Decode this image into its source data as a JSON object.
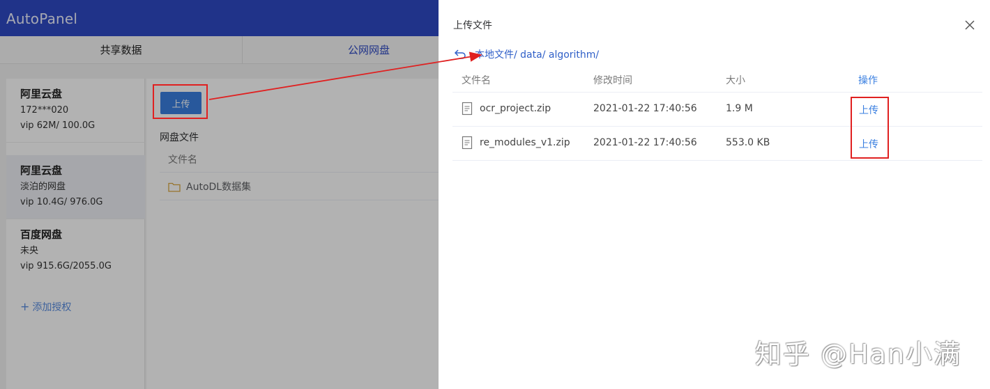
{
  "app": {
    "brand": "AutoPanel",
    "tabs": [
      {
        "label": "共享数据"
      },
      {
        "label": "公网网盘"
      }
    ],
    "accent_color": "#2f49c4"
  },
  "sidebar": {
    "disks": [
      {
        "name": "阿里云盘",
        "user": "172***020",
        "quota": "vip 62M/ 100.0G"
      },
      {
        "name": "阿里云盘",
        "user": "淡泊的网盘",
        "quota": "vip 10.4G/ 976.0G"
      },
      {
        "name": "百度网盘",
        "user": "未央",
        "quota": "vip 915.6G/2055.0G"
      }
    ],
    "add_label": "添加授权"
  },
  "content": {
    "upload_label": "上传",
    "section_title": "网盘文件",
    "column_name": "文件名",
    "folder": "AutoDL数据集"
  },
  "drawer": {
    "title": "上传文件",
    "breadcrumb": "本地文件/ data/ algorithm/",
    "columns": {
      "name": "文件名",
      "time": "修改时间",
      "size": "大小",
      "action": "操作"
    },
    "rows": [
      {
        "name": "ocr_project.zip",
        "time": "2021-01-22 17:40:56",
        "size": "1.9 M",
        "action": "上传"
      },
      {
        "name": "re_modules_v1.zip",
        "time": "2021-01-22 17:40:56",
        "size": "553.0 KB",
        "action": "上传"
      }
    ]
  },
  "annotation": {
    "color": "#e02020"
  },
  "watermark": "知乎 @Han小满"
}
